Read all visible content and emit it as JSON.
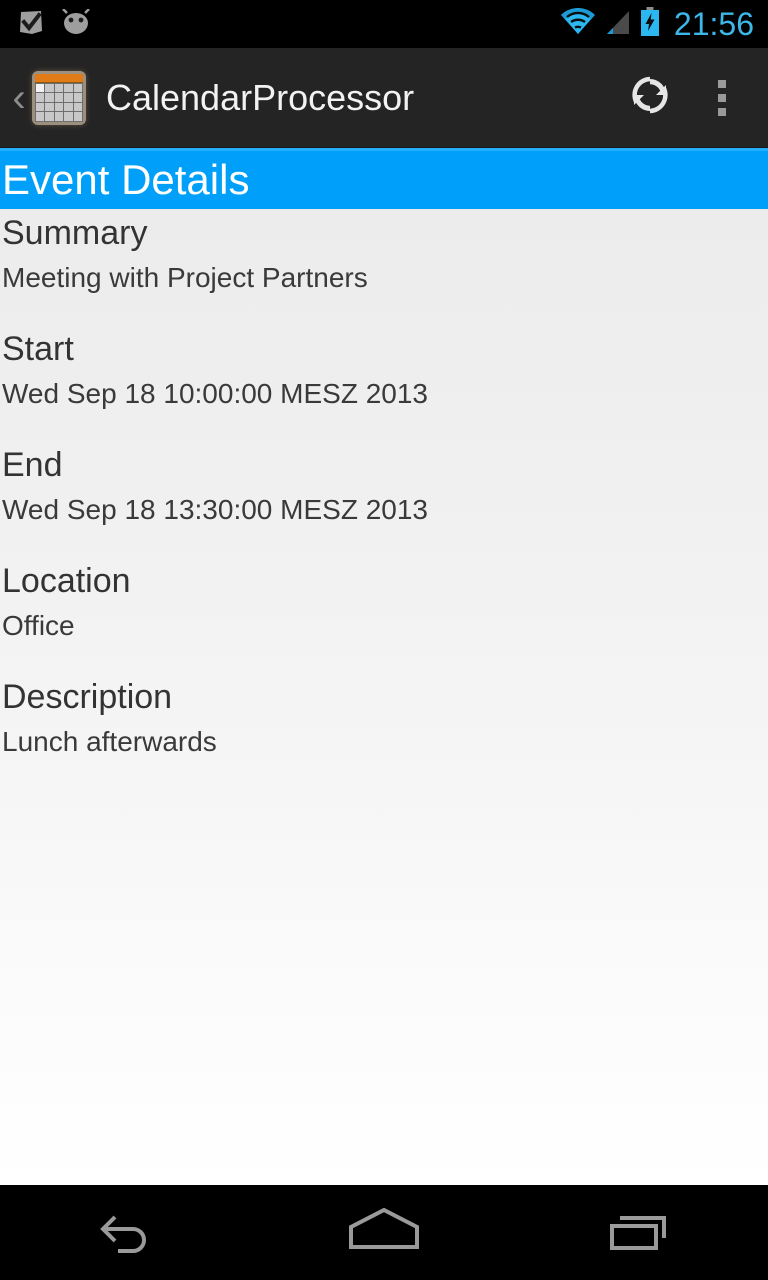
{
  "status_bar": {
    "icons": [
      {
        "name": "checkmark-badge-icon"
      },
      {
        "name": "android-head-icon"
      },
      {
        "name": "wifi-icon"
      },
      {
        "name": "cell-signal-icon"
      },
      {
        "name": "battery-charging-icon"
      }
    ],
    "time": "21:56",
    "time_color": "#3cb7e8"
  },
  "action_bar": {
    "up_chevron": "‹",
    "app_icon_name": "calendar-app-icon",
    "title": "CalendarProcessor",
    "actions": [
      {
        "name": "refresh-icon",
        "label": "Refresh"
      },
      {
        "name": "overflow-menu-icon",
        "label": "More options"
      }
    ]
  },
  "section": {
    "title": "Event Details",
    "accent_color": "#00a0fa"
  },
  "event": {
    "fields": [
      {
        "label": "Summary",
        "value": "Meeting with Project Partners"
      },
      {
        "label": "Start",
        "value": "Wed Sep 18 10:00:00 MESZ 2013"
      },
      {
        "label": "End",
        "value": "Wed Sep 18 13:30:00 MESZ 2013"
      },
      {
        "label": "Location",
        "value": "Office"
      },
      {
        "label": "Description",
        "value": "Lunch afterwards"
      }
    ]
  },
  "nav_bar": {
    "buttons": [
      {
        "name": "back-icon",
        "label": "Back"
      },
      {
        "name": "home-icon",
        "label": "Home"
      },
      {
        "name": "recents-icon",
        "label": "Recent apps"
      }
    ]
  }
}
